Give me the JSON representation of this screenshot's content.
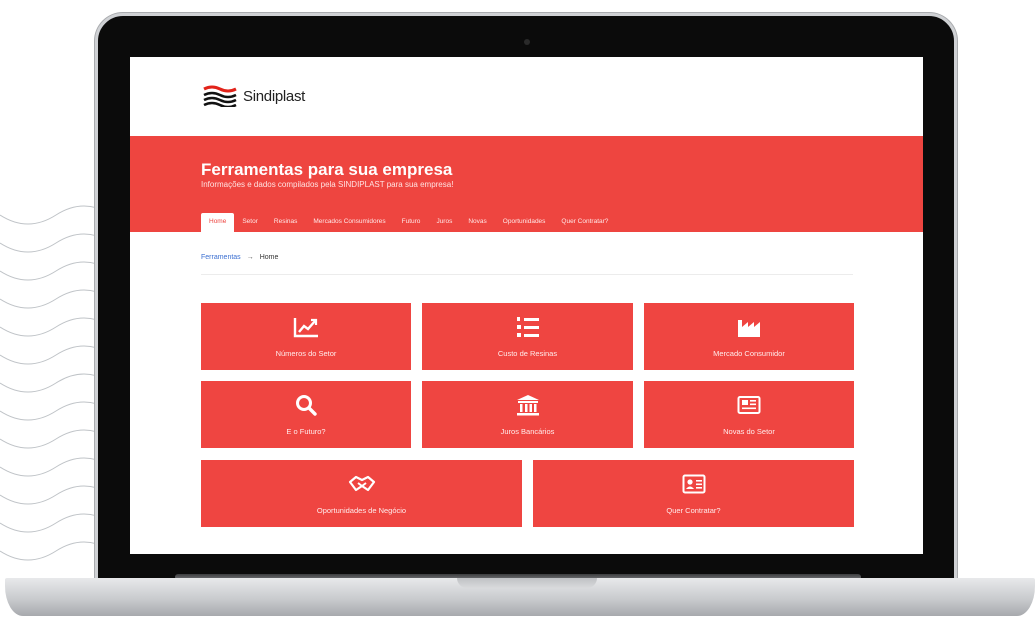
{
  "site": {
    "brand_name": "Sindiplast"
  },
  "hero": {
    "title": "Ferramentas para sua empresa",
    "subtitle": "Informações e dados compilados pela SINDIPLAST para sua empresa!"
  },
  "tabs": [
    {
      "label": "Home",
      "active": true
    },
    {
      "label": "Setor"
    },
    {
      "label": "Resinas"
    },
    {
      "label": "Mercados Consumidores"
    },
    {
      "label": "Futuro"
    },
    {
      "label": "Juros"
    },
    {
      "label": "Novas"
    },
    {
      "label": "Oportunidades"
    },
    {
      "label": "Quer Contratar?"
    }
  ],
  "breadcrumb": {
    "parent": "Ferramentas",
    "separator": "→",
    "current": "Home"
  },
  "tiles": [
    {
      "label": "Números do Setor",
      "icon": "chart-line-icon"
    },
    {
      "label": "Custo de Resinas",
      "icon": "numbered-list-icon"
    },
    {
      "label": "Mercado Consumidor",
      "icon": "factory-icon"
    },
    {
      "label": "E o Futuro?",
      "icon": "search-icon"
    },
    {
      "label": "Juros Bancários",
      "icon": "bank-icon"
    },
    {
      "label": "Novas do Setor",
      "icon": "newspaper-icon"
    },
    {
      "label": "Oportunidades de Negócio",
      "icon": "handshake-icon"
    },
    {
      "label": "Quer Contratar?",
      "icon": "id-card-icon"
    }
  ],
  "colors": {
    "accent": "#ee4540",
    "link": "#3b6fd1"
  }
}
